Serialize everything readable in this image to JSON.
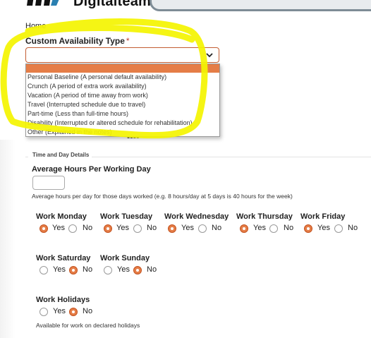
{
  "header": {
    "logo_text": "Digitalteam"
  },
  "breadcrumb": {
    "home": "Home"
  },
  "field": {
    "label": "Custom Availability Type",
    "required_mark": "*",
    "selected_value": ""
  },
  "dropdown": {
    "options": [
      "",
      "Personal Baseline (A personal default availability)",
      "Crunch (A period of extra work availability)",
      "Vacation (A period of time away from work)",
      "Travel (Interrupted schedule due to travel)",
      "Part-time (Less than full-time hours)",
      "Disability (Interrupted or altered schedule for rehabilitation)",
      "Other (Explained in the notes)"
    ],
    "highlighted_index": 0
  },
  "section": {
    "legend": "Time and Day Details"
  },
  "hours": {
    "label": "Average Hours Per Working Day",
    "value": "",
    "help": "Average hours per day for those days worked (e.g. 8 hours/day at 5 days is 40 hours for the week)"
  },
  "yes_label": "Yes",
  "no_label": "No",
  "days": [
    {
      "label": "Work Monday",
      "selected": "Yes"
    },
    {
      "label": "Work Tuesday",
      "selected": "Yes"
    },
    {
      "label": "Work Wednesday",
      "selected": "Yes"
    },
    {
      "label": "Work Thursday",
      "selected": "Yes"
    },
    {
      "label": "Work Friday",
      "selected": "Yes"
    },
    {
      "label": "Work Saturday",
      "selected": "No"
    },
    {
      "label": "Work Sunday",
      "selected": "No"
    },
    {
      "label": "Work Holidays",
      "selected": "No"
    }
  ],
  "holidays_help": "Available for work on declared holidays",
  "colors": {
    "accent": "#e57d47",
    "highlighter": "#f4f400"
  }
}
